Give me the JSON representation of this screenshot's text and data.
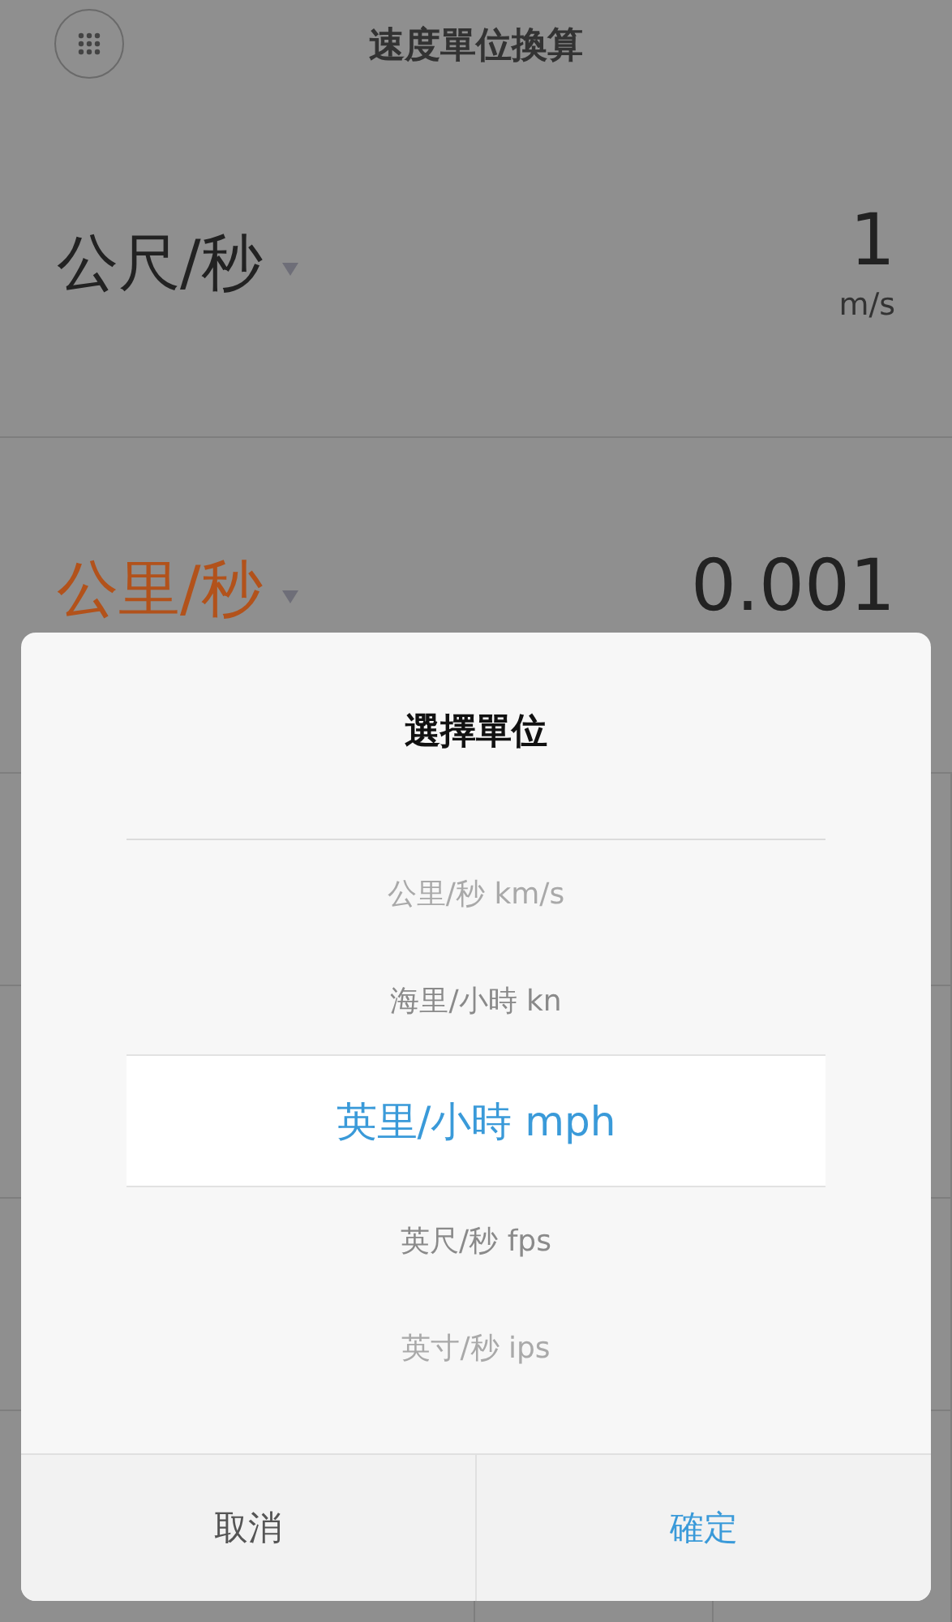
{
  "header": {
    "title": "速度單位換算"
  },
  "rows": [
    {
      "unit_name": "公尺/秒",
      "value": "1",
      "unit_symbol": "m/s",
      "active": false
    },
    {
      "unit_name": "公里/秒",
      "value": "0.001",
      "active": true
    }
  ],
  "dialog": {
    "title": "選擇單位",
    "options": [
      {
        "label": "公里/秒 km/s",
        "selected": false
      },
      {
        "label": "海里/小時 kn",
        "selected": false
      },
      {
        "label": "英里/小時 mph",
        "selected": true
      },
      {
        "label": "英尺/秒 fps",
        "selected": false
      },
      {
        "label": "英寸/秒 ips",
        "selected": false
      }
    ],
    "buttons": [
      {
        "label": "取消",
        "kind": "cancel"
      },
      {
        "label": "確定",
        "kind": "confirm"
      }
    ]
  }
}
